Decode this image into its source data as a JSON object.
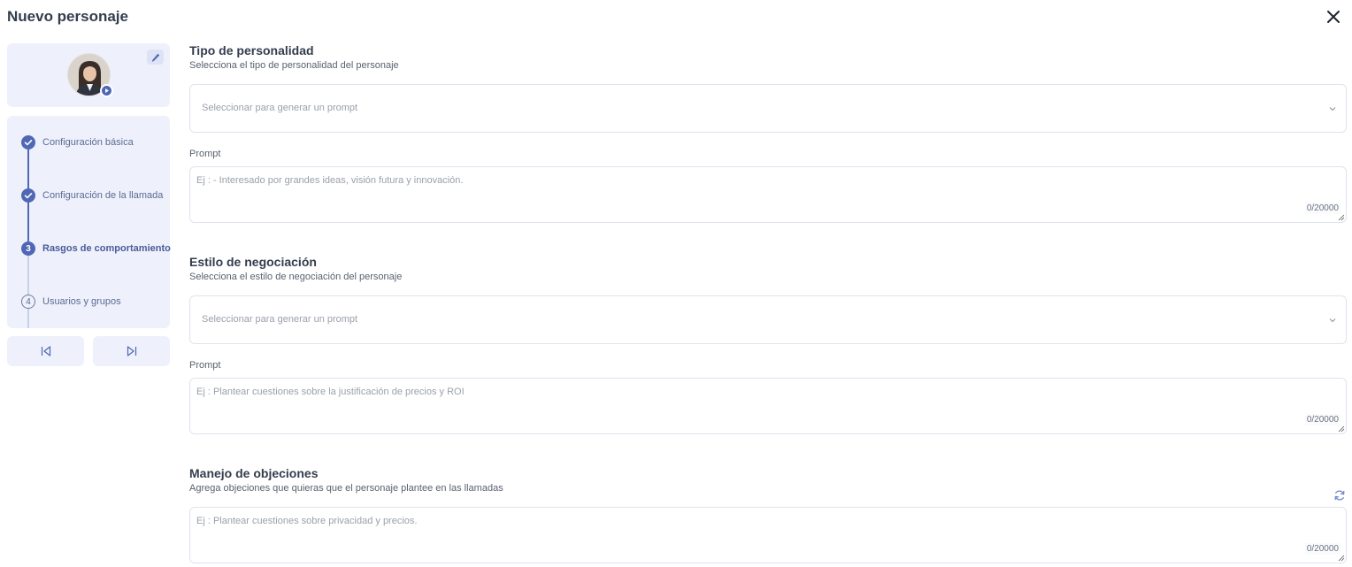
{
  "header": {
    "title": "Nuevo personaje"
  },
  "icons": {
    "close": "close-icon",
    "edit": "pencil-icon",
    "play": "play-icon",
    "prev": "first-page-icon",
    "next": "last-page-icon",
    "chevron": "chevron-down-icon",
    "refresh": "refresh-icon",
    "check": "check-icon"
  },
  "colors": {
    "accent": "#4f67b5",
    "sidebar_bg": "#eef1fb",
    "border": "#dfe3ee"
  },
  "steps": [
    {
      "label": "Configuración básica",
      "status": "done",
      "number": ""
    },
    {
      "label": "Configuración de la llamada",
      "status": "done",
      "number": ""
    },
    {
      "label": "Rasgos de comportamiento",
      "status": "active",
      "number": "3"
    },
    {
      "label": "Usuarios y grupos",
      "status": "todo",
      "number": "4"
    }
  ],
  "sections": {
    "personality": {
      "title": "Tipo de personalidad",
      "description": "Selecciona el tipo de personalidad del personaje",
      "select_placeholder": "Seleccionar para generar un prompt",
      "prompt_label": "Prompt",
      "prompt_placeholder": "Ej : - Interesado por grandes ideas, visión futura y innovación.",
      "counter": "0/20000"
    },
    "negotiation": {
      "title": "Estilo de negociación",
      "description": "Selecciona el estilo de negociación del personaje",
      "select_placeholder": "Seleccionar para generar un prompt",
      "prompt_label": "Prompt",
      "prompt_placeholder": "Ej : Plantear cuestiones sobre la justificación de precios y ROI",
      "counter": "0/20000"
    },
    "objections": {
      "title": "Manejo de objeciones",
      "description": "Agrega objeciones que quieras que el personaje plantee en las llamadas",
      "prompt_placeholder": "Ej : Plantear cuestiones sobre privacidad y precios.",
      "counter": "0/20000"
    }
  }
}
